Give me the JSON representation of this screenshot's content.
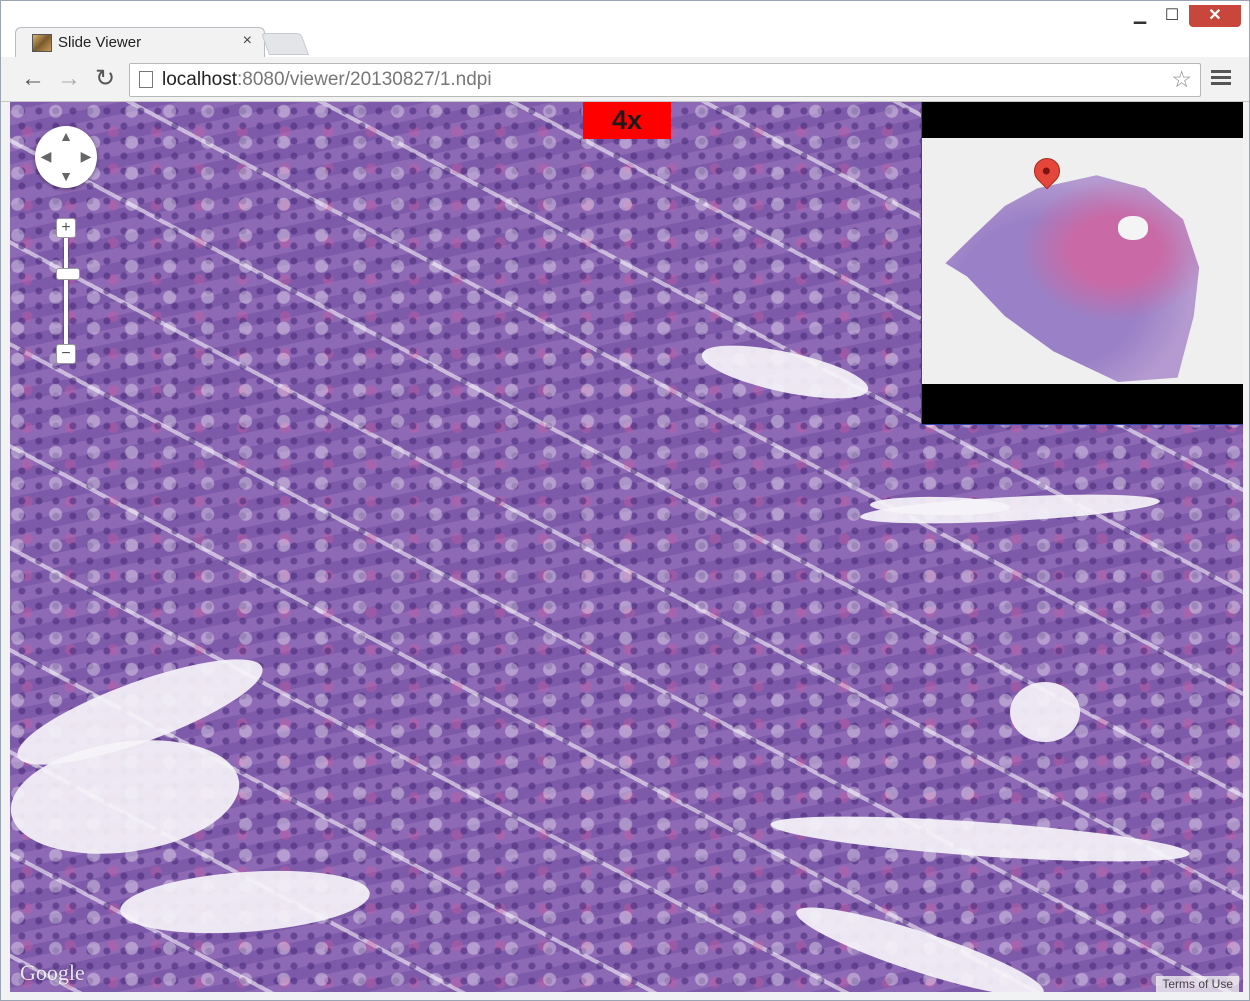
{
  "window": {
    "tab_title": "Slide Viewer",
    "tab_close": "×",
    "minimize": "▁",
    "maximize": "☐",
    "close": "✕"
  },
  "toolbar": {
    "back": "←",
    "forward": "→",
    "reload": "↻",
    "url_host": "localhost",
    "url_path": ":8080/viewer/20130827/1.ndpi",
    "star": "☆"
  },
  "viewer": {
    "magnification": "4x",
    "zoom_in": "+",
    "zoom_out": "−",
    "google_logo": "Google",
    "terms": "Terms of Use",
    "overview_marker": "map-marker"
  },
  "colors": {
    "magnification_badge": "#ff0000",
    "marker": "#e5453b",
    "tissue_stain": "#8a68b0",
    "close_button": "#c9463d"
  }
}
